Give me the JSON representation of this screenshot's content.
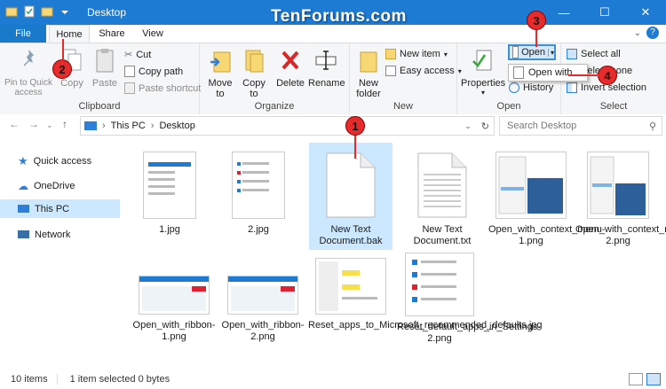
{
  "window": {
    "title": "Desktop",
    "watermark": "TenForums.com",
    "controls": {
      "minimize": "—",
      "maximize": "☐",
      "close": "✕"
    }
  },
  "tabs": {
    "file": "File",
    "home": "Home",
    "share": "Share",
    "view": "View"
  },
  "ribbon": {
    "clipboard": {
      "label": "Clipboard",
      "pin": "Pin to Quick access",
      "copy": "Copy",
      "paste": "Paste",
      "cut": "Cut",
      "copy_path": "Copy path",
      "paste_shortcut": "Paste shortcut"
    },
    "organize": {
      "label": "Organize",
      "move_to": "Move to",
      "copy_to": "Copy to",
      "delete": "Delete",
      "rename": "Rename"
    },
    "new": {
      "label": "New",
      "new_folder": "New folder",
      "new_item": "New item",
      "easy_access": "Easy access"
    },
    "open": {
      "label": "Open",
      "properties": "Properties",
      "open": "Open",
      "open_with": "Open with",
      "history": "History"
    },
    "select": {
      "label": "Select",
      "select_all": "Select all",
      "select_none": "Select none",
      "invert_selection": "Invert selection"
    }
  },
  "address": {
    "crumbs": [
      "This PC",
      "Desktop"
    ],
    "search_placeholder": "Search Desktop"
  },
  "nav": {
    "items": [
      {
        "label": "Quick access",
        "icon": "star-icon"
      },
      {
        "label": "OneDrive",
        "icon": "cloud-icon"
      },
      {
        "label": "This PC",
        "icon": "computer-icon"
      },
      {
        "label": "Network",
        "icon": "network-icon"
      }
    ]
  },
  "files": [
    {
      "name": "1.jpg"
    },
    {
      "name": "2.jpg"
    },
    {
      "name": "New Text Document.bak"
    },
    {
      "name": "New Text Document.txt"
    },
    {
      "name": "Open_with_context_menu-1.png"
    },
    {
      "name": "Open_with_context_menu-2.png"
    },
    {
      "name": "Open_with_ribbon-1.png"
    },
    {
      "name": "Open_with_ribbon-2.png"
    },
    {
      "name": "Reset_apps_to_Microsoft_recommended_defaults.jpg"
    },
    {
      "name": "Reset_default_apps_in_Settings-2.png"
    }
  ],
  "status": {
    "count": "10 items",
    "selection": "1 item selected  0 bytes"
  },
  "markers": [
    "1",
    "2",
    "3",
    "4"
  ],
  "colors": {
    "accent": "#1e7bd3",
    "selection": "#cce8ff",
    "marker": "#e52b2b"
  }
}
